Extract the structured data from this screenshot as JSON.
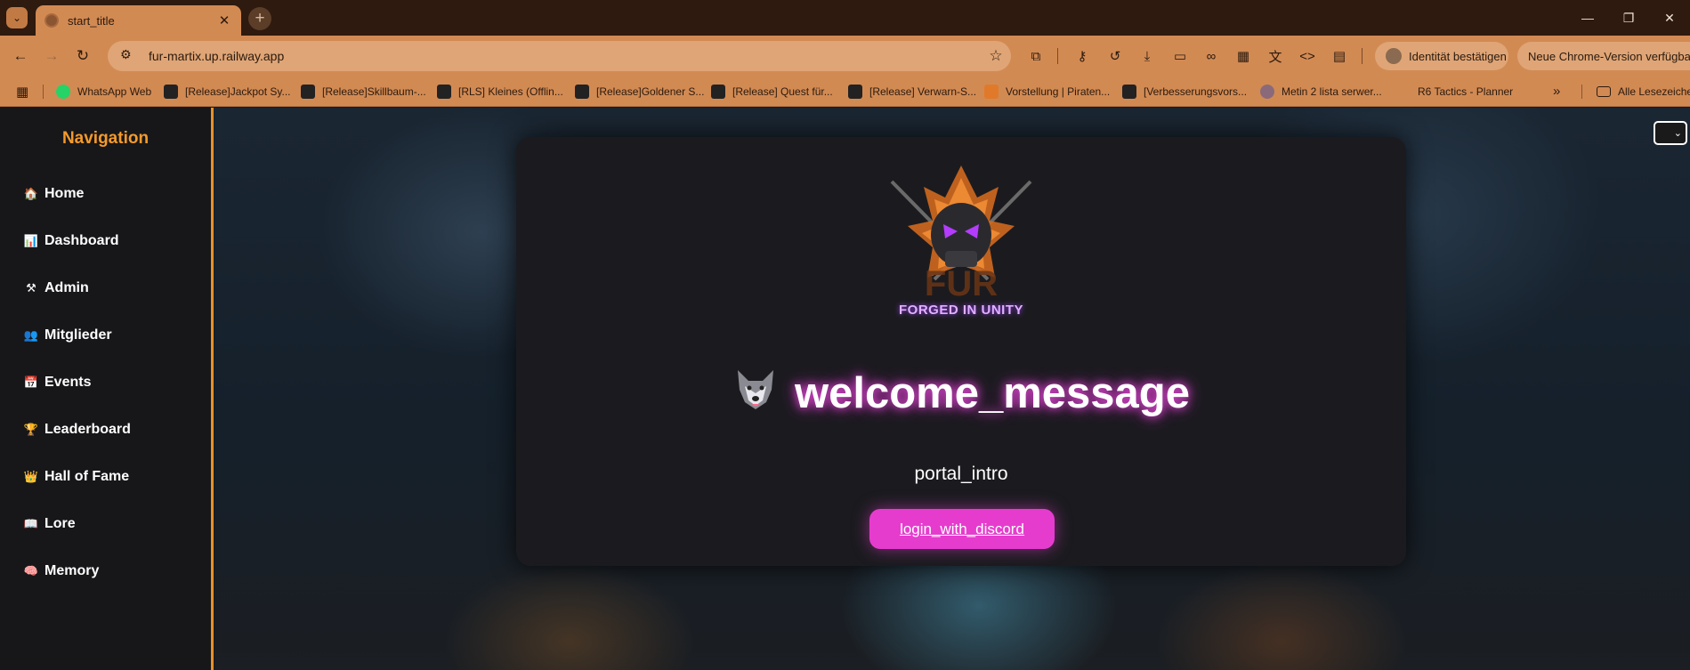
{
  "browser": {
    "tab_title": "start_title",
    "url": "fur-martix.up.railway.app",
    "identity_pill": "Identität bestätigen",
    "update_pill": "Neue Chrome-Version verfügbar",
    "bookmarks": [
      "WhatsApp Web",
      "[Release]Jackpot Sy...",
      "[Release]Skillbaum-...",
      "[RLS] Kleines (Offlin...",
      "[Release]Goldener S...",
      "[Release] Quest für...",
      "[Release] Verwarn-S...",
      "Vorstellung | Piraten...",
      "[Verbesserungsvors...",
      "Metin 2 lista serwer...",
      "R6 Tactics - Planner"
    ],
    "all_bookmarks": "Alle Lesezeichen"
  },
  "sidebar": {
    "title": "Navigation",
    "items": [
      {
        "label": "Home",
        "icon": "house-icon"
      },
      {
        "label": "Dashboard",
        "icon": "bar-chart-icon"
      },
      {
        "label": "Admin",
        "icon": "tools-icon"
      },
      {
        "label": "Mitglieder",
        "icon": "people-icon"
      },
      {
        "label": "Events",
        "icon": "calendar-icon"
      },
      {
        "label": "Leaderboard",
        "icon": "trophy-icon"
      },
      {
        "label": "Hall of Fame",
        "icon": "crown-icon"
      },
      {
        "label": "Lore",
        "icon": "book-icon"
      },
      {
        "label": "Memory",
        "icon": "brain-icon"
      }
    ]
  },
  "main": {
    "logo_text": "FORGED IN UNITY",
    "welcome": "welcome_message",
    "intro": "portal_intro",
    "login_button": "login_with_discord"
  },
  "colors": {
    "accent_orange": "#f59a2a",
    "button_pink": "#e63cce",
    "chrome_tan": "#d28a53"
  }
}
